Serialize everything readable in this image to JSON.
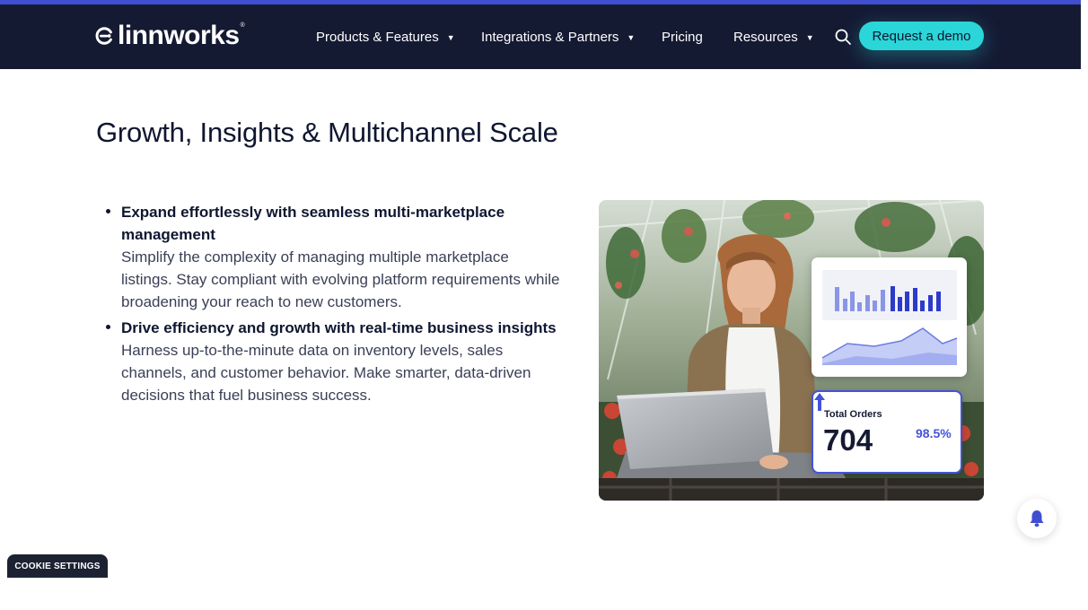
{
  "header": {
    "logo_text": "linnworks",
    "logo_reg": "®",
    "nav": [
      {
        "label": "Products & Features",
        "has_dropdown": true
      },
      {
        "label": "Integrations & Partners",
        "has_dropdown": true
      },
      {
        "label": "Pricing",
        "has_dropdown": false
      },
      {
        "label": "Resources",
        "has_dropdown": true
      }
    ],
    "caret": "▼",
    "search_icon": "search-icon",
    "cta_label": "Request a demo"
  },
  "main": {
    "title": "Growth, Insights & Multichannel Scale",
    "bullets": [
      {
        "heading": "Expand effortlessly with seamless multi-marketplace management",
        "body": "Simplify the complexity of managing multiple marketplace listings. Stay compliant with evolving platform requirements while broadening your reach to new customers."
      },
      {
        "heading": "Drive efficiency and growth with real-time business insights",
        "body": "Harness up-to-the-minute data on inventory levels, sales channels, and customer behavior. Make smarter, data-driven decisions that fuel business success."
      }
    ]
  },
  "hero": {
    "orders_label": "Total Orders",
    "orders_value": "704",
    "orders_change": "98.5%"
  },
  "footer": {
    "cookie_label": "COOKIE SETTINGS",
    "bell_icon": "bell-icon"
  },
  "colors": {
    "nav_bg": "#151a33",
    "accent_line": "#3f4fd0",
    "cta": "#2ad6d8",
    "brand_blue": "#4453d8"
  }
}
